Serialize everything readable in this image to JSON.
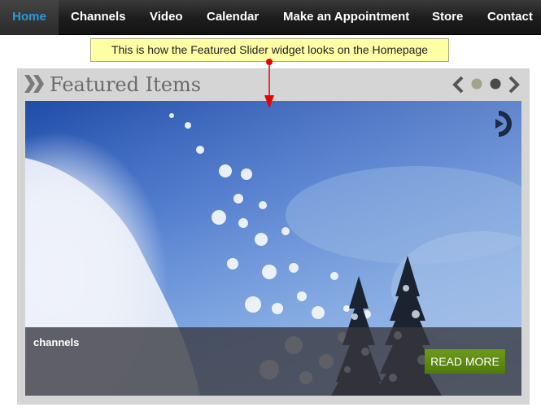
{
  "nav": {
    "items": [
      {
        "label": "Home",
        "active": true
      },
      {
        "label": "Channels",
        "active": false
      },
      {
        "label": "Video",
        "active": false
      },
      {
        "label": "Calendar",
        "active": false
      },
      {
        "label": "Make an Appointment",
        "active": false
      },
      {
        "label": "Store",
        "active": false
      },
      {
        "label": "Contact",
        "active": false
      }
    ]
  },
  "callout": {
    "text": "This is how the Featured Slider widget looks on the Homepage",
    "arrow_color": "#e60000"
  },
  "widget": {
    "title": "Featured Items",
    "title_icon": "double-chevron-right-icon",
    "controls": {
      "prev_icon": "chevron-left-icon",
      "next_icon": "chevron-right-icon",
      "dots": [
        {
          "active": false
        },
        {
          "active": true
        }
      ]
    },
    "slide": {
      "image": "snow-powder-trees-sky-image",
      "play_icon": "play-pause-icon",
      "caption_title": "channels",
      "read_more_label": "READ MORE"
    }
  },
  "colors": {
    "nav_active_text": "#2a9ad8",
    "read_more_bg": "#5f8c14",
    "callout_bg": "#ffffa6"
  }
}
